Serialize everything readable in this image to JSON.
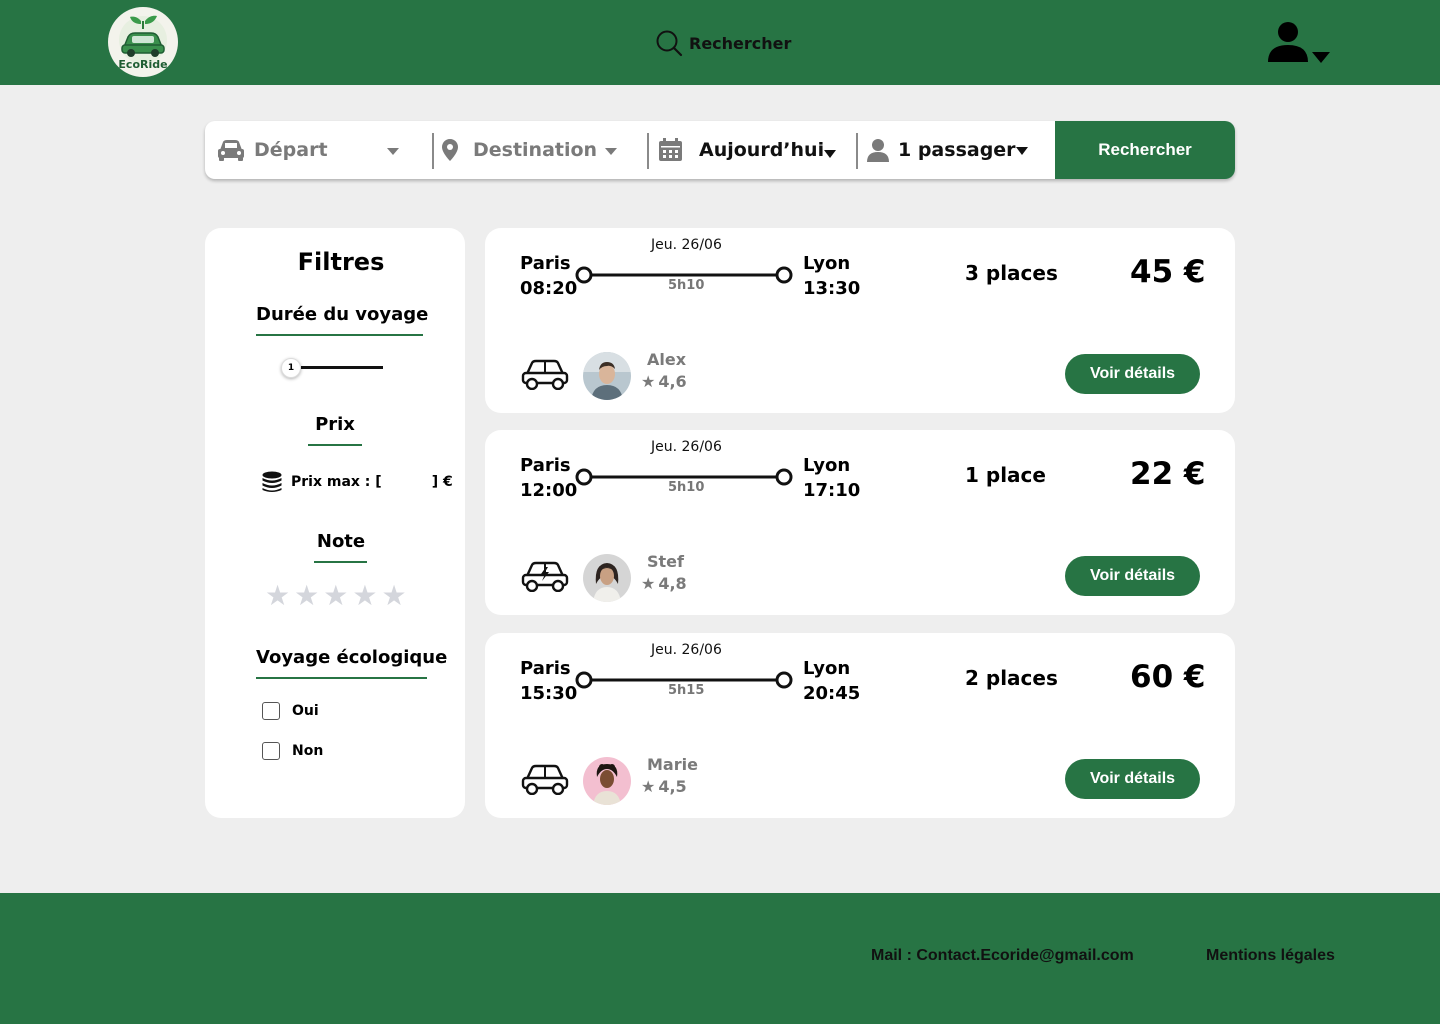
{
  "brand": {
    "name": "EcoRide",
    "primary_color": "#277444",
    "background": "#eeeeee"
  },
  "header": {
    "search_label": "Rechercher",
    "search_icon": "search-icon",
    "user_icon": "user-icon"
  },
  "search_bar": {
    "departure": {
      "placeholder": "Départ",
      "icon": "car-icon"
    },
    "destination": {
      "placeholder": "Destination",
      "icon": "map-pin-icon"
    },
    "date": {
      "value": "Aujourd’hui",
      "icon": "calendar-icon"
    },
    "passengers": {
      "value": "1 passager",
      "icon": "user-icon"
    },
    "submit_label": "Rechercher"
  },
  "filters": {
    "title": "Filtres",
    "duration": {
      "title": "Durée du voyage",
      "slider_value": "1"
    },
    "price": {
      "title": "Prix",
      "label": "Prix max : [",
      "suffix": "] €",
      "icon": "coins-icon"
    },
    "rating": {
      "title": "Note",
      "stars_max": 5,
      "stars_selected": 0
    },
    "eco": {
      "title": "Voyage écologique",
      "options": [
        "Oui",
        "Non"
      ]
    }
  },
  "trips": [
    {
      "date": "Jeu. 26/06",
      "from_city": "Paris",
      "from_time": "08:20",
      "to_city": "Lyon",
      "to_time": "13:30",
      "duration": "5h10",
      "places": "3 places",
      "price": "45 €",
      "vehicle": "car-icon",
      "driver": "Alex",
      "rating": "4,6",
      "details_label": "Voir détails"
    },
    {
      "date": "Jeu. 26/06",
      "from_city": "Paris",
      "from_time": "12:00",
      "to_city": "Lyon",
      "to_time": "17:10",
      "duration": "5h10",
      "places": "1 place",
      "price": "22 €",
      "vehicle": "electric-car-icon",
      "driver": "Stef",
      "rating": "4,8",
      "details_label": "Voir détails"
    },
    {
      "date": "Jeu. 26/06",
      "from_city": "Paris",
      "from_time": "15:30",
      "to_city": "Lyon",
      "to_time": "20:45",
      "duration": "5h15",
      "places": "2 places",
      "price": "60 €",
      "vehicle": "car-icon",
      "driver": "Marie",
      "rating": "4,5",
      "details_label": "Voir détails"
    }
  ],
  "footer": {
    "mail": "Mail : Contact.Ecoride@gmail.com",
    "legal": "Mentions légales"
  }
}
